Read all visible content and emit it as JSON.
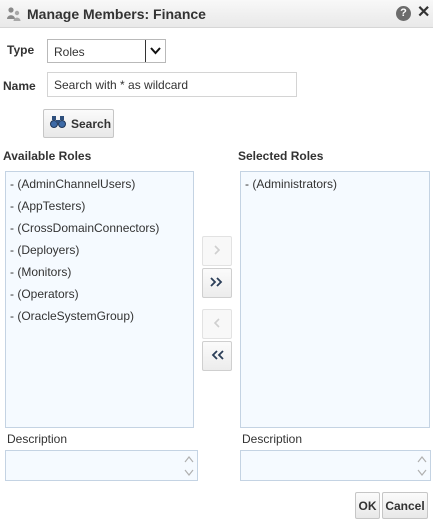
{
  "dialog": {
    "title": "Manage Members: Finance",
    "help_icon": "?",
    "close_icon": "✕"
  },
  "form": {
    "type_label": "Type",
    "type_value": "Roles",
    "name_label": "Name",
    "name_placeholder": "Search with * as wildcard",
    "search_label": "Search"
  },
  "available": {
    "title": "Available Roles",
    "items": [
      "- (AdminChannelUsers)",
      "- (AppTesters)",
      "- (CrossDomainConnectors)",
      "- (Deployers)",
      "- (Monitors)",
      "- (Operators)",
      "- (OracleSystemGroup)"
    ]
  },
  "selected": {
    "title": "Selected Roles",
    "items": [
      "- (Administrators)"
    ]
  },
  "description": {
    "left_label": "Description",
    "right_label": "Description"
  },
  "footer": {
    "ok_label": "OK",
    "cancel_label": "Cancel"
  },
  "icons": {
    "app": "manage-members-icon",
    "help": "help-icon",
    "close": "close-icon",
    "search": "binoculars-icon",
    "move": "chevron-right-icon",
    "move_all": "double-chevron-right-icon",
    "remove": "chevron-left-icon",
    "remove_all": "double-chevron-left-icon"
  },
  "colors": {
    "list_background": "#f5faff",
    "list_border": "#c4d3e3",
    "title_bar": "#efefef"
  }
}
